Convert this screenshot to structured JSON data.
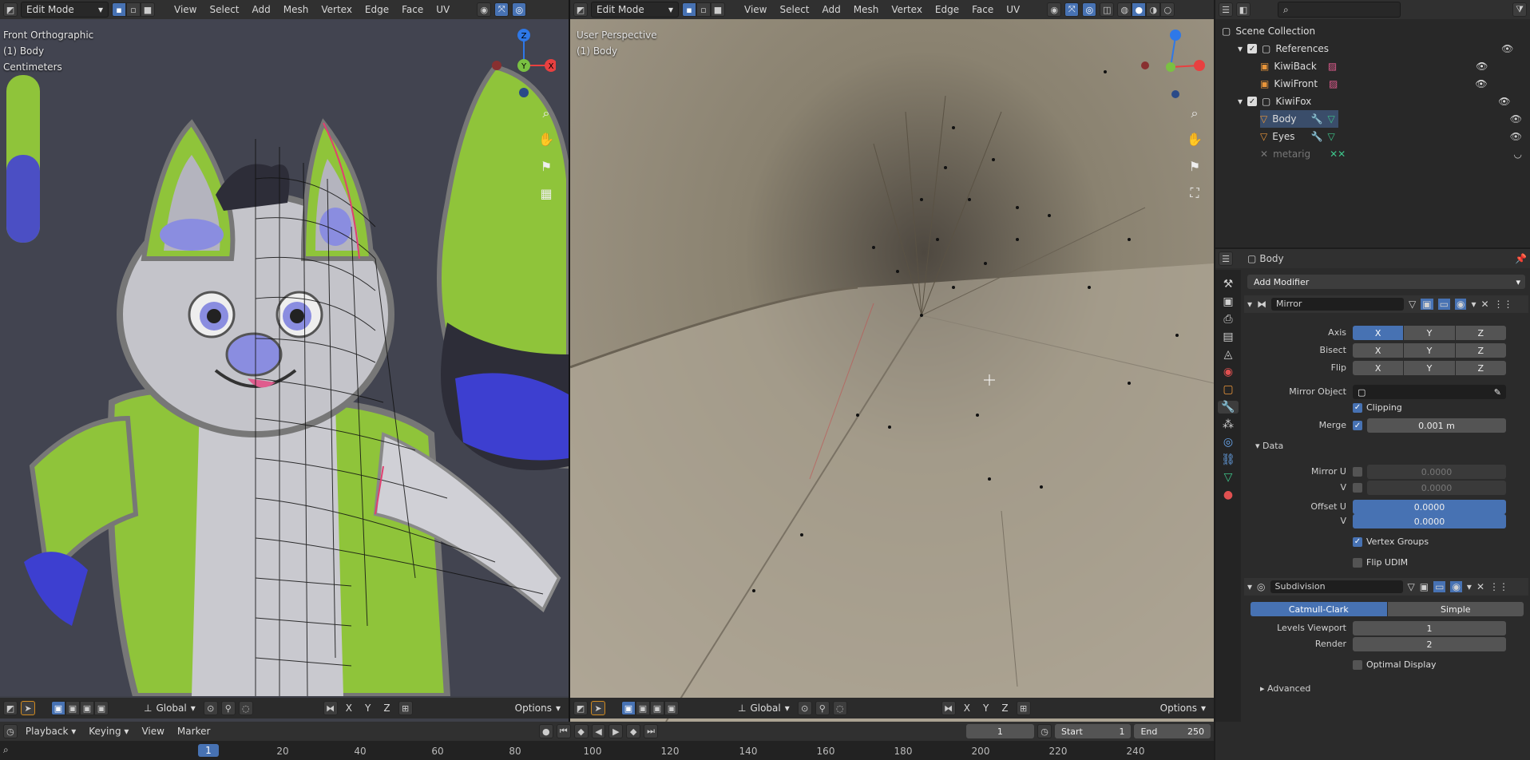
{
  "left_viewport": {
    "mode": "Edit Mode",
    "menus": [
      "View",
      "Select",
      "Add",
      "Mesh",
      "Vertex",
      "Edge",
      "Face",
      "UV"
    ],
    "overlay_lines": [
      "Front Orthographic",
      "(1) Body",
      "Centimeters"
    ],
    "footer": {
      "orientation": "Global",
      "axes": [
        "X",
        "Y",
        "Z"
      ],
      "options": "Options"
    }
  },
  "right_viewport": {
    "mode": "Edit Mode",
    "menus": [
      "View",
      "Select",
      "Add",
      "Mesh",
      "Vertex",
      "Edge",
      "Face",
      "UV"
    ],
    "overlay_lines": [
      "User Perspective",
      "(1) Body"
    ],
    "footer": {
      "orientation": "Global",
      "axes": [
        "X",
        "Y",
        "Z"
      ],
      "options": "Options"
    }
  },
  "outliner": {
    "search_placeholder": "",
    "items": [
      {
        "label": "Scene Collection",
        "type": "scene"
      },
      {
        "label": "References",
        "type": "collection",
        "checked": true
      },
      {
        "label": "KiwiBack",
        "type": "image"
      },
      {
        "label": "KiwiFront",
        "type": "image"
      },
      {
        "label": "KiwiFox",
        "type": "collection",
        "checked": true
      },
      {
        "label": "Body",
        "type": "mesh"
      },
      {
        "label": "Eyes",
        "type": "mesh"
      },
      {
        "label": "metarig",
        "type": "armature"
      }
    ]
  },
  "properties": {
    "object_name": "Body",
    "add_modifier": "Add Modifier",
    "mirror": {
      "name": "Mirror",
      "axis_label": "Axis",
      "bisect_label": "Bisect",
      "flip_label": "Flip",
      "axes": [
        "X",
        "Y",
        "Z"
      ],
      "mirror_object_label": "Mirror Object",
      "clipping_label": "Clipping",
      "merge_label": "Merge",
      "merge_value": "0.001 m",
      "data_label": "Data",
      "mirror_u_label": "Mirror U",
      "mirror_u_value": "0.0000",
      "v_label": "V",
      "mirror_v_value": "0.0000",
      "offset_u_label": "Offset U",
      "offset_u_value": "0.0000",
      "offset_v_value": "0.0000",
      "vertex_groups_label": "Vertex Groups",
      "flip_udim_label": "Flip UDIM"
    },
    "subdivision": {
      "name": "Subdivision",
      "catmull_label": "Catmull-Clark",
      "simple_label": "Simple",
      "levels_viewport_label": "Levels Viewport",
      "levels_viewport_value": "1",
      "render_label": "Render",
      "render_value": "2",
      "optimal_display_label": "Optimal Display",
      "advanced_label": "Advanced"
    }
  },
  "timeline": {
    "menus": [
      "Playback",
      "Keying",
      "View",
      "Marker"
    ],
    "current_frame": "1",
    "start_label": "Start",
    "start_value": "1",
    "end_label": "End",
    "end_value": "250",
    "ruler_current": "1",
    "ruler_ticks": [
      "20",
      "40",
      "60",
      "80",
      "100",
      "120",
      "140",
      "160",
      "180",
      "200",
      "220",
      "240"
    ]
  },
  "colors": {
    "accent": "#4772b3",
    "fox_green": "#8fc43a",
    "fox_blue": "#3d3fd0",
    "mesh_active": "#ff8a00"
  }
}
